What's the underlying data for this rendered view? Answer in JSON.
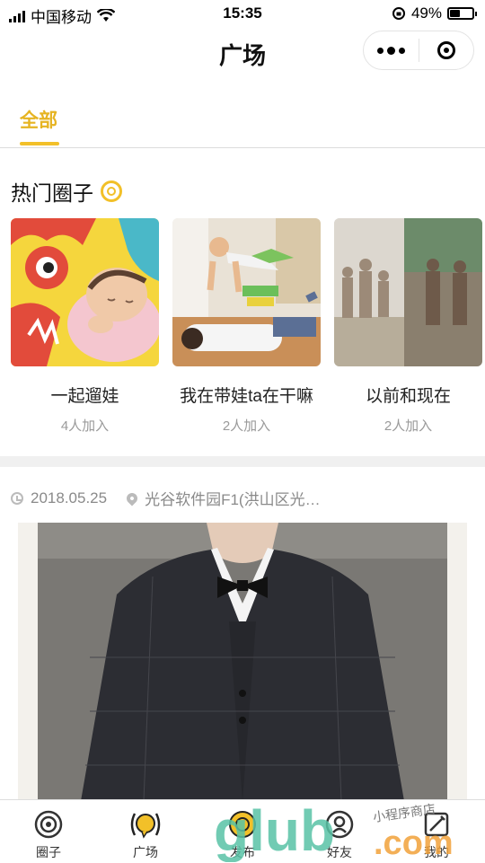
{
  "status_bar": {
    "carrier": "中国移动",
    "time": "15:35",
    "battery": "49%",
    "battery_level": 0.49
  },
  "header": {
    "title": "广场"
  },
  "tabs": [
    {
      "label": "全部",
      "active": true
    }
  ],
  "hot_section": {
    "title": "热门圈子",
    "icon": "hot-circle-icon",
    "circles": [
      {
        "name": "一起遛娃",
        "members": "4人加入"
      },
      {
        "name": "我在带娃ta在干嘛",
        "members": "2人加入"
      },
      {
        "name": "以前和现在",
        "members": "2人加入"
      }
    ]
  },
  "post": {
    "date": "2018.05.25",
    "location": "光谷软件园F1(洪山区光…"
  },
  "tabbar": {
    "items": [
      {
        "label": "圈子",
        "icon": "circle-icon"
      },
      {
        "label": "广场",
        "icon": "square-icon",
        "active": true
      },
      {
        "label": "发布",
        "icon": "publish-icon"
      },
      {
        "label": "好友",
        "icon": "friends-icon"
      },
      {
        "label": "我的",
        "icon": "profile-icon"
      }
    ]
  },
  "watermark": {
    "text": "glub.com",
    "tagline": "小程序商店"
  },
  "colors": {
    "accent": "#f2c029",
    "text": "#111111",
    "muted": "#9a9a9a"
  }
}
